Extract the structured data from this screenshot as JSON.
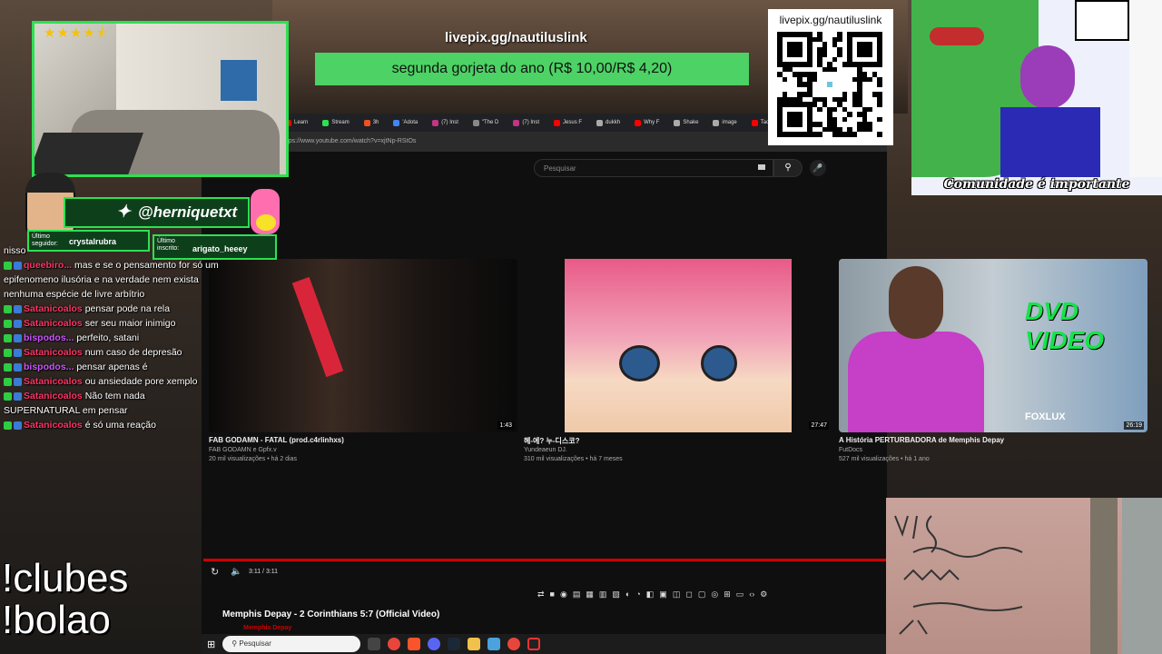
{
  "overlay": {
    "pix_url": "livepix.gg/nautiluslink",
    "tip_text": "segunda gorjeta do ano (R$ 10,00/R$ 4,20)",
    "qr_url": "livepix.gg/nautiluslink",
    "twitter_handle": "@herniquetxt",
    "follower_label": "Último seguidor:",
    "follower_name": "crystalrubra",
    "subscriber_label": "Último inscrito:",
    "subscriber_name": "arigato_heeey",
    "cartoon_caption": "Comunidade é importante",
    "commands": [
      "!clubes",
      "!bolao"
    ],
    "rating_stars": 4.5,
    "accent_color": "#2de052"
  },
  "chat": {
    "messages": [
      {
        "user": "",
        "text": "nisso"
      },
      {
        "user": "queebiro...",
        "text": "mas e se o pensamento for só um epifenomeno ilusória e na verdade nem exista nenhuma espécie de livre arbítrio"
      },
      {
        "user": "Satanicoalos",
        "text": "pensar pode na rela"
      },
      {
        "user": "Satanicoalos",
        "text": "ser seu maior inimigo"
      },
      {
        "user": "bispodos...",
        "text": "perfeito, satani"
      },
      {
        "user": "Satanicoalos",
        "text": "num caso de depresão"
      },
      {
        "user": "bispodos...",
        "text": "pensar apenas é"
      },
      {
        "user": "Satanicoalos",
        "text": "ou ansiedade pore xemplo"
      },
      {
        "user": "Satanicoalos",
        "text": "Não tem nada SUPERNATURAL em pensar"
      },
      {
        "user": "Satanicoalos",
        "text": "é só uma reação"
      }
    ]
  },
  "browser": {
    "tabs": [
      "Learn",
      "Stream",
      "3h",
      "'Adota",
      "(7) Inst",
      "\"The D",
      "(7) Inst",
      "Jesus F",
      "dukkh",
      "Why F",
      "Shake",
      "image",
      "Tao"
    ],
    "url": "https://www.youtube.com/watch?v=xjtNp-RStOs",
    "search_placeholder": "Pesquisar",
    "videos": [
      {
        "title": "FAB GODAMN - FATAL (prod.c4rlinhxs)",
        "channel": "FAB GODAMN e Gpfx.v",
        "meta": "20 mil visualizações • há 2 dias",
        "duration": "1:43"
      },
      {
        "title": "헤-에? 누-디스코?",
        "channel": "Yundeaeun DJ.",
        "meta": "310 mil visualizações • há 7 meses",
        "duration": "27:47"
      },
      {
        "title": "A História PERTURBADORA de Memphis Depay",
        "channel": "FutDocs",
        "meta": "527 mil visualizações • há 1 ano",
        "duration": "26:19"
      }
    ],
    "time": "3:11 / 3:11",
    "progress": 1.0,
    "now_playing_title": "Memphis Depay - 2 Corinthians 5:7 (Official Video)",
    "channel_name": "Memphis Depay",
    "thumb3_overlay": "DVD VIDEO",
    "thumb3_brand": "FOXLUX"
  },
  "taskbar": {
    "search_placeholder": "Pesquisar"
  }
}
